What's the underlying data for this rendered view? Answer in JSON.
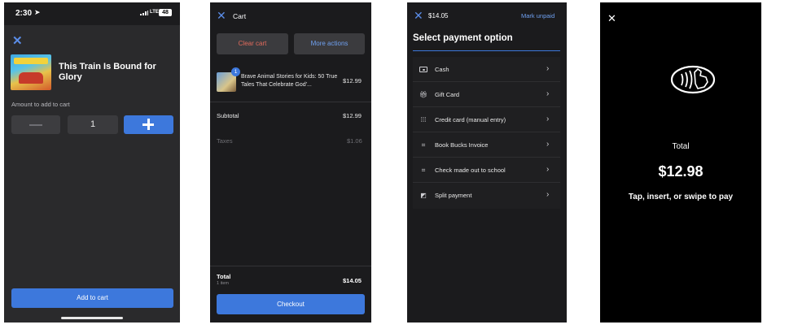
{
  "screen1": {
    "status": {
      "time": "2:30",
      "network": "LTE",
      "battery": "48"
    },
    "product_title": "This Train Is Bound for Glory",
    "amount_label": "Amount to add to cart",
    "quantity": "1",
    "add_to_cart_label": "Add to cart"
  },
  "screen2": {
    "title": "Cart",
    "clear_cart_label": "Clear cart",
    "more_actions_label": "More actions",
    "item": {
      "badge": "1",
      "name": "Brave Animal Stories for Kids: 50 True Tales That Celebrate God'...",
      "price": "$12.99"
    },
    "subtotal_label": "Subtotal",
    "subtotal_value": "$12.99",
    "taxes_label": "Taxes",
    "taxes_value": "$1.06",
    "total_label": "Total",
    "total_items": "1 item",
    "total_value": "$14.05",
    "checkout_label": "Checkout"
  },
  "screen3": {
    "amount": "$14.05",
    "mark_unpaid_label": "Mark unpaid",
    "heading": "Select payment option",
    "options": [
      {
        "label": "Cash",
        "icon": "cash-icon"
      },
      {
        "label": "Gift Card",
        "icon": "gift-icon"
      },
      {
        "label": "Credit card (manual entry)",
        "icon": "keypad-icon"
      },
      {
        "label": "Book Bucks Invoice",
        "icon": "invoice-icon"
      },
      {
        "label": "Check made out to school",
        "icon": "check-icon"
      },
      {
        "label": "Split payment",
        "icon": "split-icon"
      }
    ]
  },
  "screen4": {
    "total_label": "Total",
    "total_value": "$12.98",
    "instruction": "Tap, insert, or swipe to pay"
  },
  "colors": {
    "accent": "#3d78dc",
    "link": "#6fa0f0",
    "danger": "#e36b5c",
    "panel": "#1b1b1d"
  }
}
